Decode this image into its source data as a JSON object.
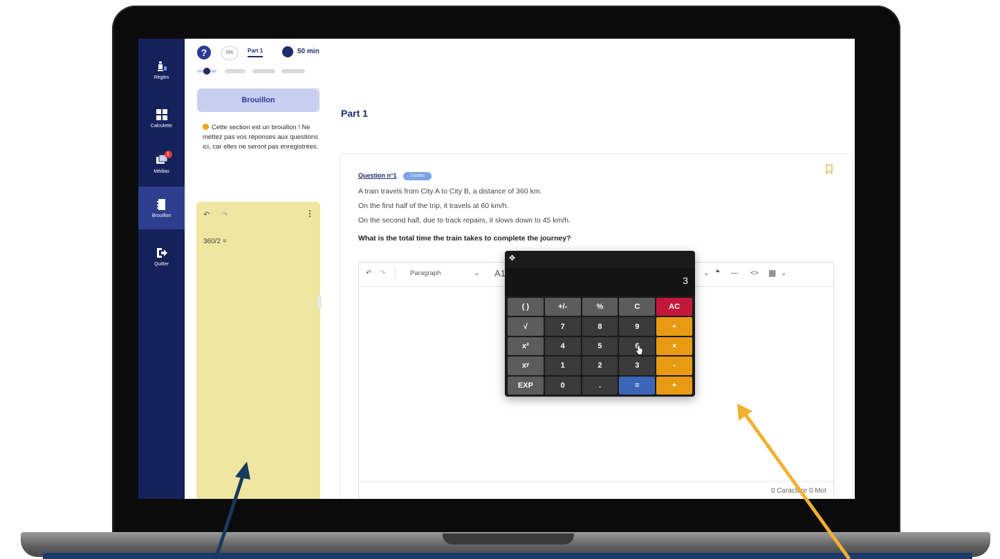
{
  "nav": {
    "items": [
      {
        "label": "Règles",
        "icon": "rules-chess-icon"
      },
      {
        "label": "Calculette",
        "icon": "calculator-icon"
      },
      {
        "label": "Médias",
        "icon": "media-icon",
        "badge": "1"
      },
      {
        "label": "Brouillon",
        "icon": "draft-notebook-icon",
        "active": true
      },
      {
        "label": "Quitter",
        "icon": "exit-icon"
      }
    ]
  },
  "topbar": {
    "help": "?",
    "percent": "0%",
    "part_tab": "Part 1",
    "timer": "50 min"
  },
  "draft": {
    "button_label": "Brouillon",
    "notice": "Cette section est un brouillon ! Ne mettez pas vos réponses aux questions ici, car elles ne seront pas enregistrées.",
    "undo": "↶",
    "redo": "↷",
    "menu": "⋮",
    "content": "360/2 ="
  },
  "main": {
    "title": "Part 1",
    "question": {
      "label": "Question n°1",
      "points": "2 points",
      "lines": [
        "A train travels from City A to City B, a distance of 360 km.",
        "On the first half of the trip, it travels at 60 km/h.",
        "On the second half, due to track repairs, it slows down to 45 km/h."
      ],
      "prompt": "What is the total time the train takes to complete the journey?"
    },
    "editor": {
      "undo": "↶",
      "redo": "↷",
      "paragraph": "Paragraph",
      "font_hint": "A1",
      "chevron": "⌄",
      "quote": "❝",
      "hr": "—",
      "code": "<>",
      "table": "▦",
      "footer": "0 Caractère 0 Mot"
    }
  },
  "calculator": {
    "move_icon": "✥",
    "display": "3",
    "keys": [
      {
        "label": "( )",
        "kind": "fn"
      },
      {
        "label": "+/-",
        "kind": "fn"
      },
      {
        "label": "%",
        "kind": "fn"
      },
      {
        "label": "C",
        "kind": "fn"
      },
      {
        "label": "AC",
        "kind": "ac"
      },
      {
        "label": "√",
        "kind": "fn"
      },
      {
        "label": "7",
        "kind": "num"
      },
      {
        "label": "8",
        "kind": "num"
      },
      {
        "label": "9",
        "kind": "num"
      },
      {
        "label": "÷",
        "kind": "op"
      },
      {
        "label": "x²",
        "kind": "fn"
      },
      {
        "label": "4",
        "kind": "num"
      },
      {
        "label": "5",
        "kind": "num"
      },
      {
        "label": "6",
        "kind": "num"
      },
      {
        "label": "×",
        "kind": "op"
      },
      {
        "label": "xʸ",
        "kind": "fn"
      },
      {
        "label": "1",
        "kind": "num"
      },
      {
        "label": "2",
        "kind": "num"
      },
      {
        "label": "3",
        "kind": "num"
      },
      {
        "label": "-",
        "kind": "op"
      },
      {
        "label": "EXP",
        "kind": "fn"
      },
      {
        "label": "0",
        "kind": "num"
      },
      {
        "label": ".",
        "kind": "num"
      },
      {
        "label": "=",
        "kind": "eq"
      },
      {
        "label": "+",
        "kind": "op"
      }
    ]
  },
  "colors": {
    "nav_bg": "#14215a",
    "brand": "#1d2a6b",
    "draft_bg": "#eee6a1",
    "arrow_left": "#183a5e",
    "arrow_right": "#f2b033"
  }
}
